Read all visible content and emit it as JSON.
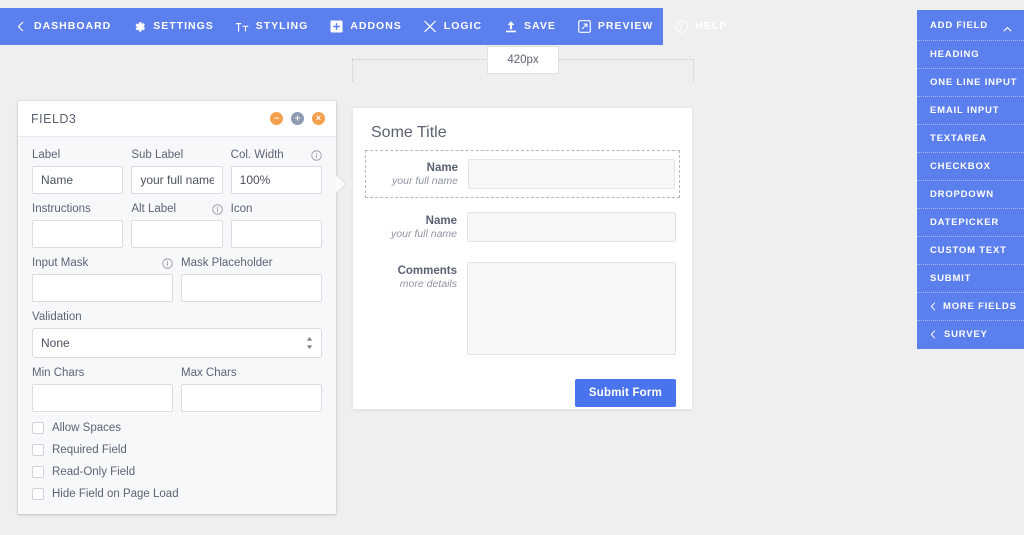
{
  "toolbar": {
    "items": [
      {
        "label": "DASHBOARD",
        "icon": "chevron-left-icon"
      },
      {
        "label": "SETTINGS",
        "icon": "gear-icon"
      },
      {
        "label": "STYLING",
        "icon": "text-size-icon"
      },
      {
        "label": "ADDONS",
        "icon": "plus-square-icon"
      },
      {
        "label": "LOGIC",
        "icon": "shuffle-icon"
      },
      {
        "label": "SAVE",
        "icon": "upload-icon"
      },
      {
        "label": "PREVIEW",
        "icon": "external-link-icon"
      },
      {
        "label": "HELP",
        "icon": "question-circle-icon"
      }
    ]
  },
  "ruler": {
    "width_badge": "420px"
  },
  "field_panel": {
    "title": "FIELD3",
    "buttons": {
      "collapse": "−",
      "add": "+",
      "close": "×"
    },
    "fields": {
      "label": {
        "label": "Label",
        "value": "Name",
        "placeholder": ""
      },
      "sub_label": {
        "label": "Sub Label",
        "value": "your full name",
        "placeholder": ""
      },
      "col_width": {
        "label": "Col. Width",
        "value": "100%",
        "placeholder": "",
        "info": true
      },
      "instructions": {
        "label": "Instructions",
        "value": "",
        "placeholder": ""
      },
      "alt_label": {
        "label": "Alt Label",
        "value": "",
        "placeholder": "",
        "info": true
      },
      "icon": {
        "label": "Icon",
        "value": "",
        "placeholder": ""
      },
      "input_mask": {
        "label": "Input Mask",
        "value": "",
        "placeholder": "",
        "info": true
      },
      "mask_placeholder": {
        "label": "Mask Placeholder",
        "value": "",
        "placeholder": ""
      },
      "validation": {
        "label": "Validation",
        "value": "None"
      },
      "min_chars": {
        "label": "Min Chars",
        "value": "",
        "placeholder": ""
      },
      "max_chars": {
        "label": "Max Chars",
        "value": "",
        "placeholder": ""
      }
    },
    "checkboxes": [
      {
        "label": "Allow Spaces",
        "checked": false
      },
      {
        "label": "Required Field",
        "checked": false
      },
      {
        "label": "Read-Only Field",
        "checked": false
      },
      {
        "label": "Hide Field on Page Load",
        "checked": false
      }
    ]
  },
  "form_preview": {
    "title": "Some Title",
    "rows": [
      {
        "label": "Name",
        "sub": "your full name",
        "type": "input",
        "selected": true
      },
      {
        "label": "Name",
        "sub": "your full name",
        "type": "input",
        "selected": false
      },
      {
        "label": "Comments",
        "sub": "more details",
        "type": "textarea",
        "selected": false
      }
    ],
    "submit_label": "Submit Form"
  },
  "add_field": {
    "header": {
      "label": "ADD FIELD",
      "icon": "chevron-up-icon"
    },
    "items": [
      {
        "label": "HEADING",
        "icon": ""
      },
      {
        "label": "ONE LINE INPUT",
        "icon": ""
      },
      {
        "label": "EMAIL INPUT",
        "icon": ""
      },
      {
        "label": "TEXTAREA",
        "icon": ""
      },
      {
        "label": "CHECKBOX",
        "icon": ""
      },
      {
        "label": "DROPDOWN",
        "icon": ""
      },
      {
        "label": "DATEPICKER",
        "icon": ""
      },
      {
        "label": "CUSTOM TEXT",
        "icon": ""
      },
      {
        "label": "SUBMIT",
        "icon": ""
      },
      {
        "label": "MORE FIELDS",
        "icon": "chevron-left-icon"
      },
      {
        "label": "SURVEY",
        "icon": "chevron-left-icon"
      }
    ]
  },
  "colors": {
    "toolbar_blue": "#5b7fec",
    "submit_blue": "#4a73ee",
    "accent_orange": "#f5a04f",
    "accent_gray": "#8e9bb3",
    "canvas": "#efefef",
    "panel_body": "#f7f8fa"
  }
}
